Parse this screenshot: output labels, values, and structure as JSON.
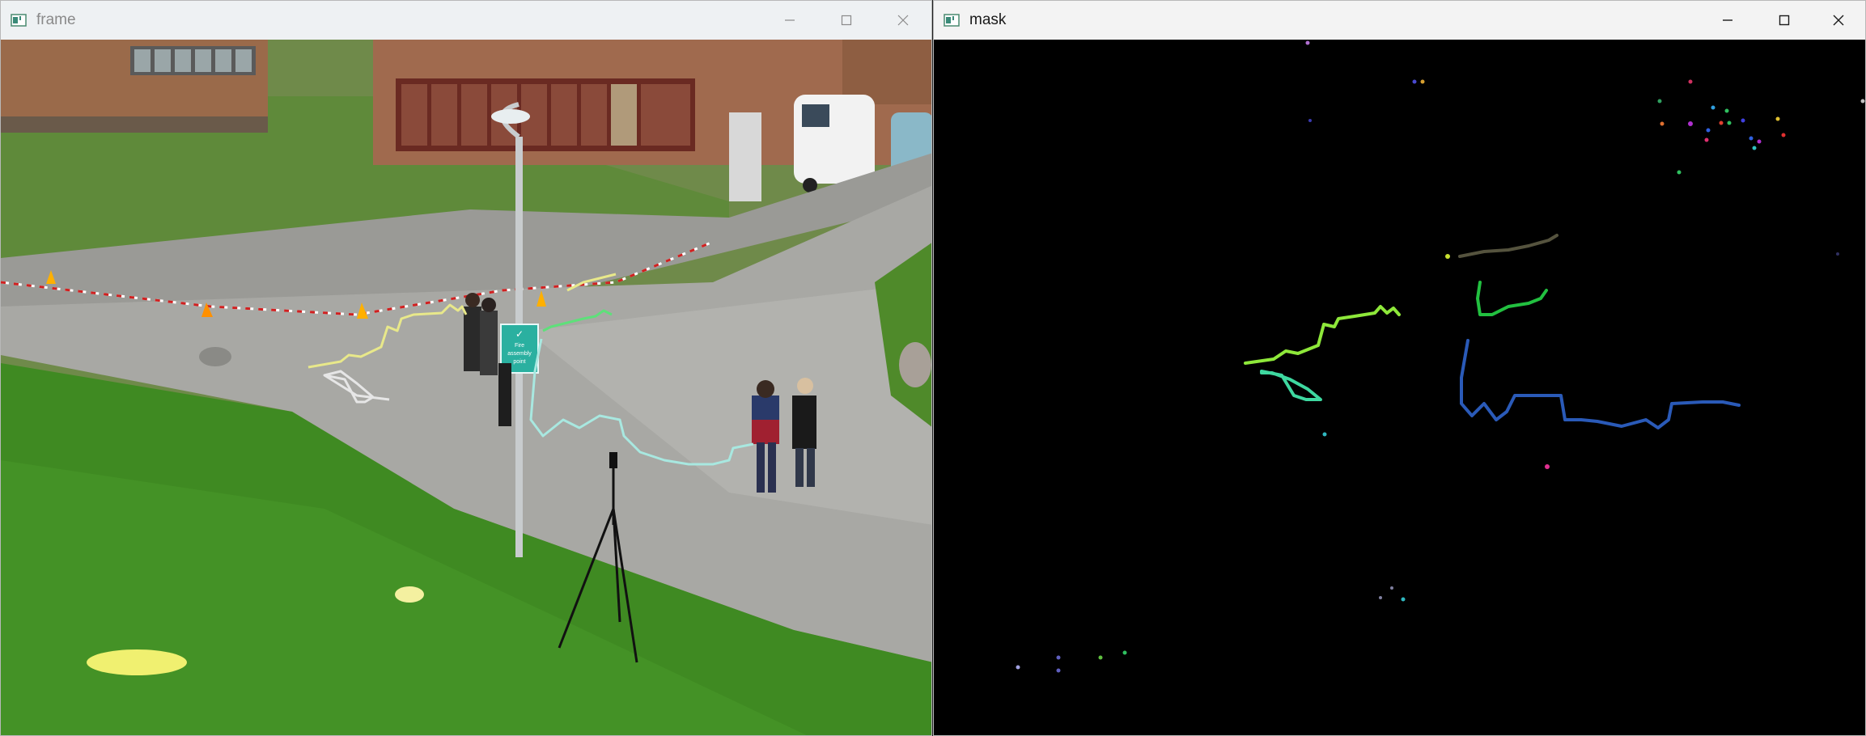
{
  "windows": {
    "frame": {
      "title": "frame",
      "controls": [
        "minimize-icon",
        "maximize-icon",
        "close-icon"
      ]
    },
    "mask": {
      "title": "mask",
      "controls": [
        "minimize-icon",
        "maximize-icon",
        "close-icon"
      ]
    }
  },
  "scene": {
    "sign_text": "Fire\nassembly\npoint",
    "sign_lines": [
      "Fire",
      "assembly",
      "point"
    ]
  },
  "colors": {
    "mask_background": "#000000",
    "track_yellow": "#e8e88a",
    "track_white": "#e6e6e6",
    "track_cyan": "#a8e8e0",
    "track_green": "#5ee07a",
    "track_lime": "#8ee83a",
    "track_blue": "#2a5ab8",
    "track_olive": "#55533e",
    "track_teal": "#3ed8a0"
  }
}
